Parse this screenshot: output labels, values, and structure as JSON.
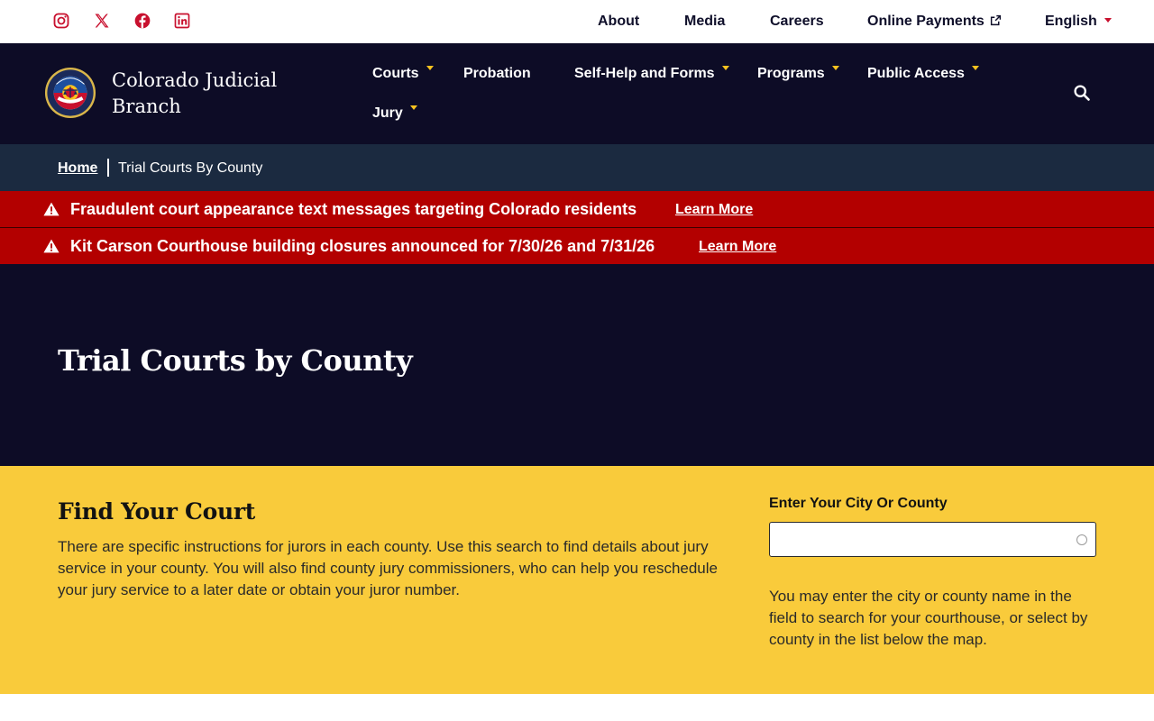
{
  "utility": {
    "social": [
      {
        "name": "instagram-icon",
        "color": "#c8102e"
      },
      {
        "name": "x-twitter-icon",
        "color": "#c8102e"
      },
      {
        "name": "facebook-icon",
        "color": "#c8102e"
      },
      {
        "name": "linkedin-icon",
        "color": "#c8102e"
      }
    ],
    "links": {
      "about": "About",
      "media": "Media",
      "careers": "Careers",
      "online_payments": "Online Payments",
      "language": "English"
    }
  },
  "brand": {
    "name": "Colorado Judicial Branch",
    "seal_icon": "colorado-courts-seal-icon"
  },
  "nav": {
    "courts": "Courts",
    "probation": "Probation",
    "self_help": "Self-Help and Forms",
    "programs": "Programs",
    "public_access": "Public Access",
    "jury": "Jury",
    "search_icon": "search-icon"
  },
  "breadcrumb": {
    "home": "Home",
    "current": "Trial Courts By County"
  },
  "alerts": [
    {
      "icon": "warning-icon",
      "text": "Fraudulent court appearance text messages targeting Colorado residents",
      "link": "Learn More"
    },
    {
      "icon": "warning-icon",
      "text": "Kit Carson Courthouse building closures announced for 7/30/26 and 7/31/26",
      "link": "Learn More"
    }
  ],
  "hero": {
    "title": "Trial Courts by County"
  },
  "find_court": {
    "title": "Find Your Court",
    "description": "There are specific instructions for jurors in each county. Use this search to find details about jury service in your county. You will also find county jury commissioners, who can help you reschedule your jury service to a later date or obtain your juror number.",
    "field_label": "Enter Your City Or County",
    "field_value": "",
    "help_text": "You may enter the city or county name in the field to search for your courthouse, or select by county in the list below the map."
  },
  "colors": {
    "navy": "#0d0c26",
    "breadcrumb_bg": "#1b2a40",
    "alert_red": "#b30000",
    "gold": "#f9cb3b",
    "accent_red": "#c8102e",
    "caret_gold": "#f9c31f"
  }
}
